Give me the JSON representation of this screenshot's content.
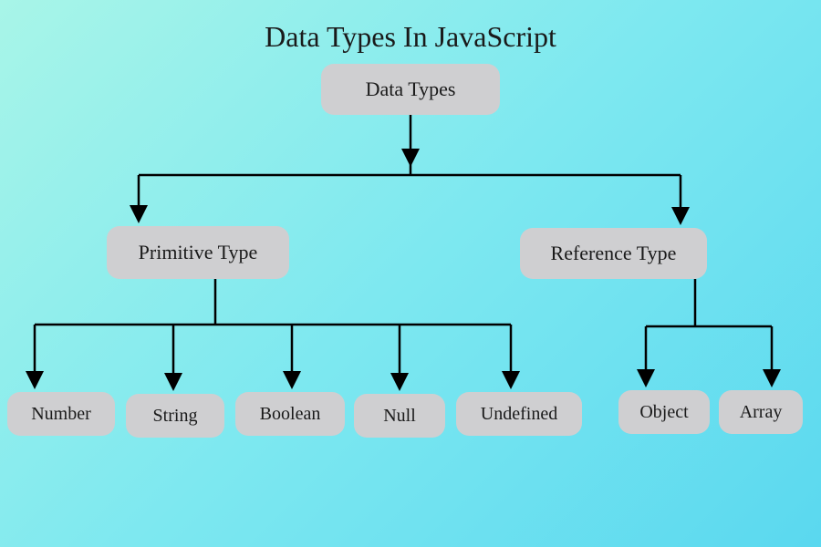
{
  "title": "Data Types In JavaScript",
  "root": {
    "label": "Data Types"
  },
  "level1": {
    "primitive": {
      "label": "Primitive Type"
    },
    "reference": {
      "label": "Reference Type"
    }
  },
  "primitive_children": {
    "number": {
      "label": "Number"
    },
    "string": {
      "label": "String"
    },
    "boolean": {
      "label": "Boolean"
    },
    "null": {
      "label": "Null"
    },
    "undefined": {
      "label": "Undefined"
    }
  },
  "reference_children": {
    "object": {
      "label": "Object"
    },
    "array": {
      "label": "Array"
    }
  }
}
